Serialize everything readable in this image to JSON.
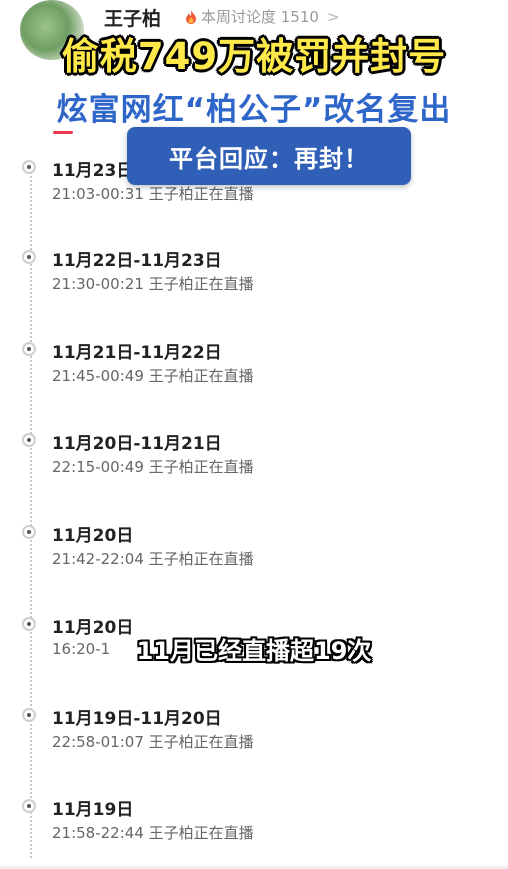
{
  "header": {
    "name": "王子柏",
    "stat_label": "本周讨论度 1510",
    "chevron": ">"
  },
  "overlay": {
    "headline_1": "偷税749万被罚并封号",
    "headline_2": "炫富网红“柏公子”改名复出",
    "badge": "平台回应：再封！",
    "caption": "11月已经直播超19次"
  },
  "colors": {
    "headline_1": "#ffe94a",
    "headline_2": "#2f66c9",
    "badge_bg": "#2f5fb7",
    "tab_accent": "#e8384f"
  },
  "timeline": [
    {
      "date": "11月23日",
      "detail": "21:03-00:31 王子柏正在直播"
    },
    {
      "date": "11月22日-11月23日",
      "detail": "21:30-00:21 王子柏正在直播"
    },
    {
      "date": "11月21日-11月22日",
      "detail": "21:45-00:49 王子柏正在直播"
    },
    {
      "date": "11月20日-11月21日",
      "detail": "22:15-00:49 王子柏正在直播"
    },
    {
      "date": "11月20日",
      "detail": "21:42-22:04 王子柏正在直播"
    },
    {
      "date": "11月20日",
      "detail": "16:20-1"
    },
    {
      "date": "11月19日-11月20日",
      "detail": "22:58-01:07 王子柏正在直播"
    },
    {
      "date": "11月19日",
      "detail": "21:58-22:44 王子柏正在直播"
    }
  ]
}
